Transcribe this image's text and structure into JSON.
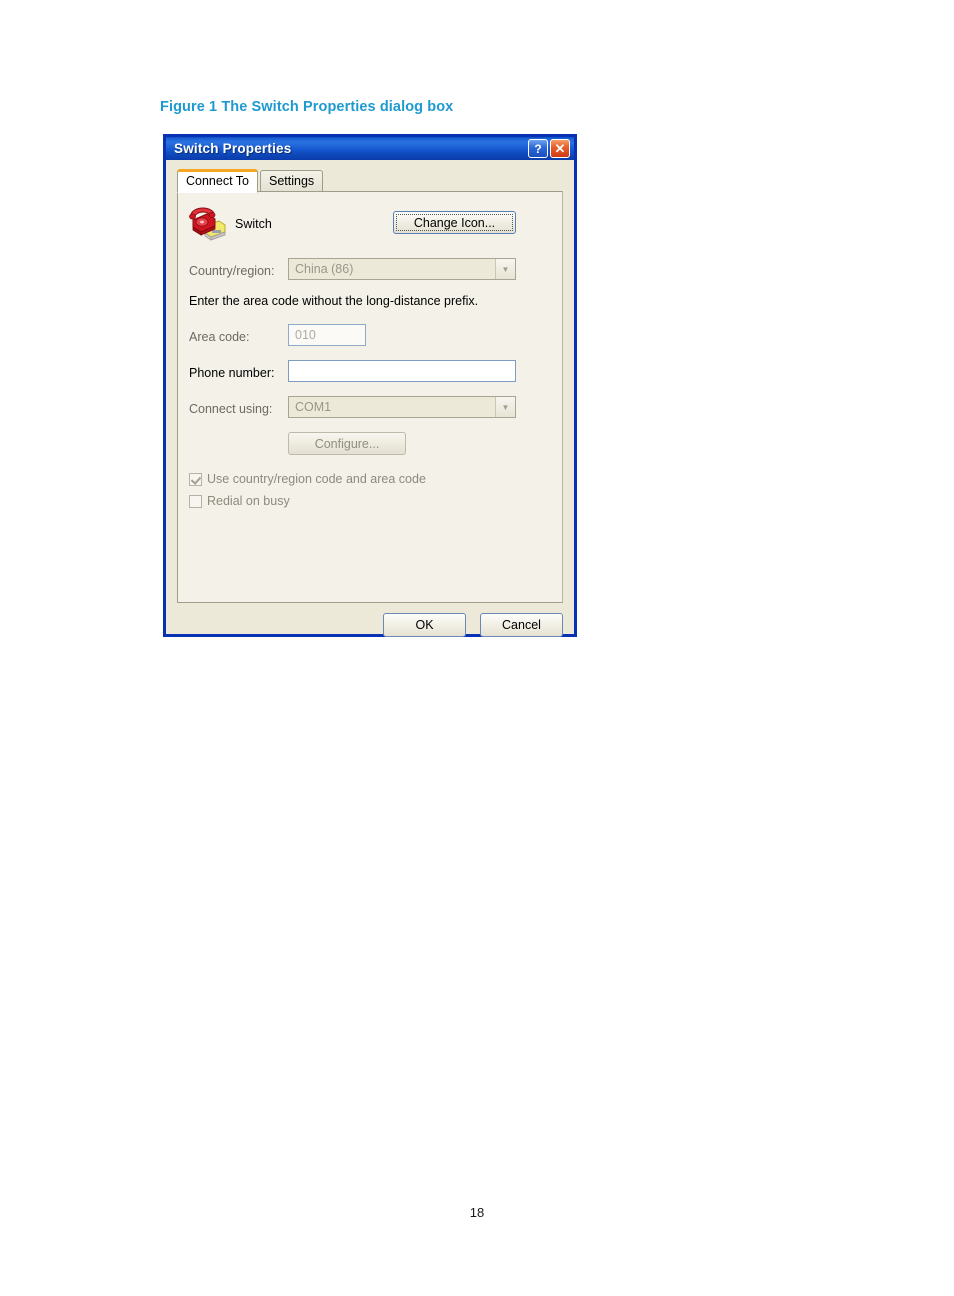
{
  "figure": {
    "caption": "Figure 1 The Switch Properties dialog box",
    "caption_color": "#1e9ad0"
  },
  "dialog": {
    "title": "Switch Properties",
    "titlebar_color": "#1a57c8",
    "border_color": "#0831b3",
    "face_color": "#ece9d8",
    "title_buttons": [
      {
        "name": "help-button",
        "glyph": "?"
      },
      {
        "name": "close-button",
        "glyph": "✕"
      }
    ],
    "tabs": [
      {
        "label": "Connect To",
        "active": true
      },
      {
        "label": "Settings",
        "active": false
      }
    ],
    "connect_to": {
      "device_label": "Switch",
      "device_icon": "telephone-icon",
      "change_icon_button": "Change Icon...",
      "country_region": {
        "label": "Country/region:",
        "value": "China (86)",
        "enabled": false
      },
      "help_text": "Enter the area code without the long-distance prefix.",
      "area_code": {
        "label": "Area code:",
        "value": "010",
        "enabled": false
      },
      "phone_number": {
        "label": "Phone number:",
        "value": "",
        "enabled": true
      },
      "connect_using": {
        "label": "Connect using:",
        "value": "COM1",
        "enabled": false
      },
      "configure_button": "Configure...",
      "checkboxes": [
        {
          "label": "Use country/region code and area code",
          "checked": true
        },
        {
          "label": "Redial on busy",
          "checked": false
        }
      ]
    },
    "footer": {
      "ok": "OK",
      "cancel": "Cancel"
    }
  },
  "page": {
    "number": "18"
  }
}
